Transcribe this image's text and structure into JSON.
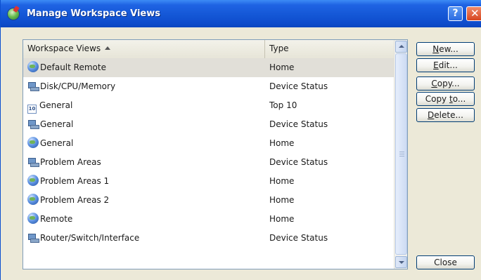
{
  "window": {
    "title": "Manage Workspace Views",
    "help_label": "?",
    "close_label": "✕"
  },
  "list": {
    "columns": [
      "Workspace Views",
      "Type"
    ],
    "sort_column": "Workspace Views",
    "sort_direction": "ascending",
    "selected_row": 0,
    "rows": [
      {
        "icon": "globe-icon",
        "name": "Default Remote",
        "type": "Home"
      },
      {
        "icon": "device-status-icon",
        "name": "Disk/CPU/Memory",
        "type": "Device Status"
      },
      {
        "icon": "top10-icon",
        "name": "General",
        "type": "Top 10"
      },
      {
        "icon": "device-status-icon",
        "name": "General",
        "type": "Device Status"
      },
      {
        "icon": "globe-icon",
        "name": "General",
        "type": "Home"
      },
      {
        "icon": "device-status-icon",
        "name": "Problem Areas",
        "type": "Device Status"
      },
      {
        "icon": "globe-icon",
        "name": "Problem Areas 1",
        "type": "Home"
      },
      {
        "icon": "globe-icon",
        "name": "Problem Areas 2",
        "type": "Home"
      },
      {
        "icon": "globe-icon",
        "name": "Remote",
        "type": "Home"
      },
      {
        "icon": "device-status-icon",
        "name": "Router/Switch/Interface",
        "type": "Device Status"
      }
    ],
    "top10_badge": "10"
  },
  "buttons": {
    "new": {
      "pre": "",
      "key": "N",
      "post": "ew..."
    },
    "edit": {
      "pre": "",
      "key": "E",
      "post": "dit..."
    },
    "copy": {
      "pre": "",
      "key": "C",
      "post": "opy..."
    },
    "copy_to": {
      "pre": "Copy ",
      "key": "t",
      "post": "o..."
    },
    "delete": {
      "pre": "",
      "key": "D",
      "post": "elete..."
    },
    "close": {
      "pre": "Close",
      "key": "",
      "post": ""
    }
  }
}
